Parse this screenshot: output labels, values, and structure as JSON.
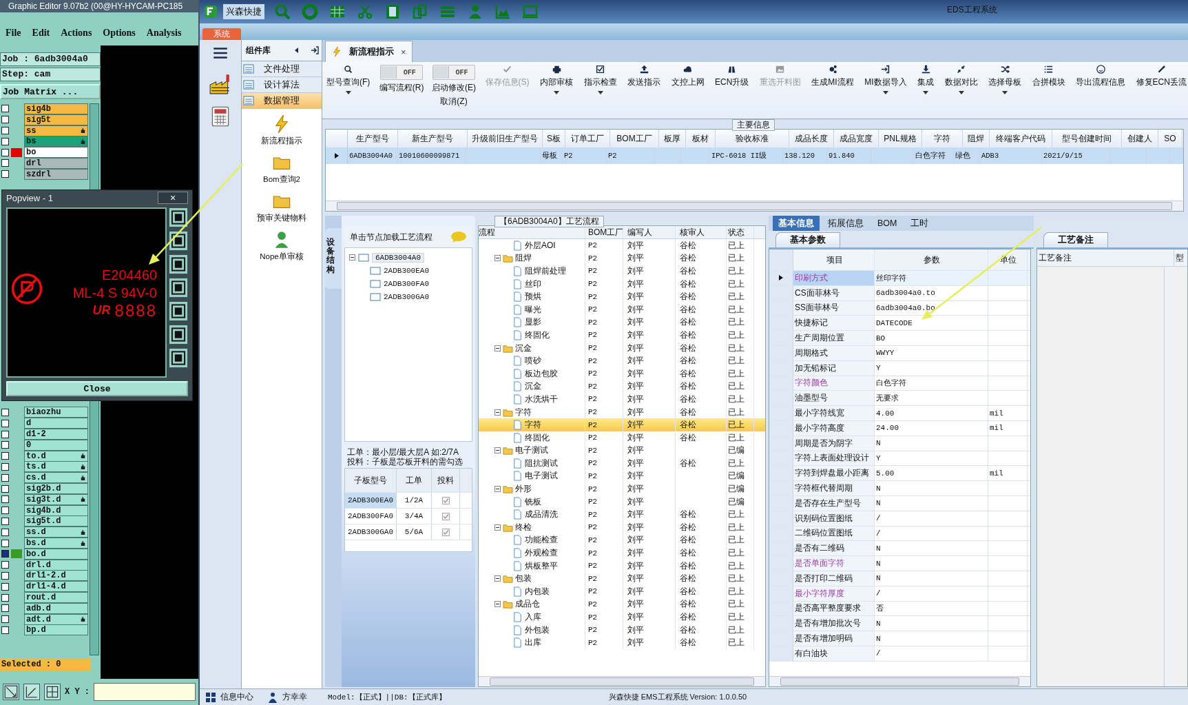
{
  "cam": {
    "title": "Graphic Editor 9.07b2 (00@HY-HYCAM-PC185",
    "menu": [
      "File",
      "Edit",
      "Actions",
      "Options",
      "Analysis"
    ],
    "job": "Job : 6adb3004a0",
    "step": "Step: cam",
    "matrix_button": "Job Matrix ...",
    "layers_top": [
      {
        "name": "sig4b",
        "color": "#f5b942",
        "flag": false,
        "selected": false
      },
      {
        "name": "sig5t",
        "color": "#f5b942",
        "flag": false,
        "selected": false
      },
      {
        "name": "ss",
        "color": "#f5b942",
        "flag": true,
        "selected": false
      },
      {
        "name": "bs",
        "color": "#1aa37a",
        "flag": true,
        "selected": false
      },
      {
        "name": "bo",
        "color": "#ffffff",
        "chip": {
          "color": "#e00000"
        },
        "flag": false,
        "selected": false
      },
      {
        "name": "drl",
        "color": "#a9b8b8",
        "flag": false,
        "selected": false
      },
      {
        "name": "szdrl",
        "color": "#a9b8b8",
        "flag": false,
        "selected": false
      }
    ],
    "layers_bottom": [
      {
        "name": "biaozhu",
        "color": "#9fe3d3",
        "flag": false,
        "selected": false
      },
      {
        "name": "d",
        "color": "#9fe3d3",
        "flag": false,
        "selected": false
      },
      {
        "name": "d1-2",
        "color": "#9fe3d3",
        "flag": false,
        "selected": false
      },
      {
        "name": "0",
        "color": "#9fe3d3",
        "flag": false,
        "selected": false
      },
      {
        "name": "to.d",
        "color": "#9fe3d3",
        "flag": true,
        "selected": false
      },
      {
        "name": "ts.d",
        "color": "#9fe3d3",
        "flag": true,
        "selected": false
      },
      {
        "name": "cs.d",
        "color": "#9fe3d3",
        "flag": true,
        "selected": false
      },
      {
        "name": "sig2b.d",
        "color": "#9fe3d3",
        "flag": false,
        "selected": false
      },
      {
        "name": "sig3t.d",
        "color": "#9fe3d3",
        "flag": true,
        "selected": false
      },
      {
        "name": "sig4b.d",
        "color": "#9fe3d3",
        "flag": false,
        "selected": false
      },
      {
        "name": "sig5t.d",
        "color": "#9fe3d3",
        "flag": false,
        "selected": false
      },
      {
        "name": "ss.d",
        "color": "#9fe3d3",
        "flag": true,
        "selected": false
      },
      {
        "name": "bs.d",
        "color": "#9fe3d3",
        "flag": true,
        "selected": false
      },
      {
        "name": "bo.d",
        "color": "#9fe3d3",
        "chip": {
          "color": "#3a9a2a"
        },
        "flag": false,
        "selected": true
      },
      {
        "name": "drl.d",
        "color": "#9fe3d3",
        "flag": false,
        "selected": false
      },
      {
        "name": "drl1-2.d",
        "color": "#9fe3d3",
        "flag": false,
        "selected": false
      },
      {
        "name": "drl1-4.d",
        "color": "#9fe3d3",
        "flag": false,
        "selected": false
      },
      {
        "name": "rout.d",
        "color": "#9fe3d3",
        "flag": false,
        "selected": false
      },
      {
        "name": "adb.d",
        "color": "#9fe3d3",
        "flag": false,
        "selected": false
      },
      {
        "name": "adt.d",
        "color": "#9fe3d3",
        "flag": true,
        "selected": false
      },
      {
        "name": "bp.d",
        "color": "#9fe3d3",
        "flag": false,
        "selected": false
      }
    ],
    "selected_count": "Selected : 0",
    "xy_label": "X Y :",
    "popview": {
      "title": "Popview - 1",
      "close_x": "×",
      "lines": [
        "E204460",
        "ML-4 S 94V-0",
        "8888"
      ],
      "ur": "UR",
      "close": "Close"
    }
  },
  "app": {
    "brand": "兴森快捷",
    "title": "EDS工程系统",
    "system_tab": "系统",
    "component_title": "组件库",
    "components": [
      {
        "label": "文件处理",
        "selected": false
      },
      {
        "label": "设计算法",
        "selected": false
      },
      {
        "label": "数据管理",
        "selected": true
      }
    ],
    "launchers": [
      "新流程指示",
      "Bom查询2",
      "预审关键物料",
      "Nope单审核"
    ],
    "doc_tab": {
      "label": "新流程指示",
      "close": "×"
    },
    "toolbar": [
      {
        "kind": "button",
        "label": "型号查询(F)",
        "dropdown": true,
        "disabled": false
      },
      {
        "kind": "toggle",
        "toggle": "OFF",
        "on": false,
        "label": "编写流程(R)"
      },
      {
        "kind": "toggle",
        "toggle": "OFF",
        "on": false,
        "label": "启动修改(E)",
        "sub": "取消(Z)"
      },
      {
        "kind": "button",
        "label": "保存信息(S)",
        "dropdown": false,
        "disabled": true
      },
      {
        "kind": "button",
        "label": "内部审核",
        "dropdown": true,
        "disabled": false
      },
      {
        "kind": "button",
        "label": "指示检查",
        "dropdown": true,
        "disabled": false
      },
      {
        "kind": "button",
        "label": "发送指示",
        "dropdown": false,
        "disabled": false
      },
      {
        "kind": "button",
        "label": "文控上网",
        "dropdown": false,
        "disabled": false
      },
      {
        "kind": "button",
        "label": "ECN升级",
        "dropdown": false,
        "disabled": false
      },
      {
        "kind": "button",
        "label": "重选开料图",
        "dropdown": false,
        "disabled": true
      },
      {
        "kind": "button",
        "label": "生成MI流程",
        "dropdown": false,
        "disabled": false
      },
      {
        "kind": "button",
        "label": "MI数据导入",
        "dropdown": true,
        "disabled": false
      },
      {
        "kind": "button",
        "label": "集成",
        "dropdown": true,
        "disabled": false
      },
      {
        "kind": "button",
        "label": "数据对比",
        "dropdown": true,
        "disabled": false
      },
      {
        "kind": "button",
        "label": "选择母板",
        "dropdown": true,
        "disabled": false
      },
      {
        "kind": "button",
        "label": "合拼模块",
        "dropdown": false,
        "disabled": false
      },
      {
        "kind": "button",
        "label": "导出流程信息",
        "dropdown": false,
        "disabled": false
      },
      {
        "kind": "button",
        "label": "修复ECN丢流",
        "dropdown": false,
        "disabled": false
      }
    ],
    "main_info": {
      "title": "主要信息",
      "columns": [
        "生产型号",
        "新生产型号",
        "升级前旧生产型号",
        "S板",
        "订单工厂",
        "BOM工厂",
        "板厚",
        "板材",
        "验收标准",
        "成品长度",
        "成品宽度",
        "PNL规格",
        "字符",
        "阻焊",
        "终端客户代码",
        "型号创建时间",
        "创建人",
        "SO"
      ],
      "rows": [
        {
          "selected": true,
          "cells": [
            "6ADB3004A0",
            "10010600099871",
            "",
            "母板",
            "P2",
            "P2",
            "",
            "",
            "IPC-6018 II级",
            "138.120",
            "91.840",
            "",
            "白色字符",
            "绿色",
            "ADB3",
            "2021/9/15",
            "",
            ""
          ]
        }
      ]
    },
    "structure": {
      "side_tab": "设备结构",
      "hint": "单击节点加载工艺流程",
      "tree": {
        "label": "6ADB3004A0",
        "expanded": true,
        "children": [
          "2ADB300EA0",
          "2ADB300FA0",
          "2ADB300GA0"
        ]
      },
      "note": [
        "工单：最小层/最大层A 如:2/7A",
        "投料：子板是芯板开料的需勾选"
      ],
      "columns": [
        "子板型号",
        "工单",
        "投料"
      ],
      "rows": [
        {
          "model": "2ADB300EA0",
          "order": "1/2A",
          "checked": true,
          "selected": true
        },
        {
          "model": "2ADB300FA0",
          "order": "3/4A",
          "checked": true,
          "selected": false
        },
        {
          "model": "2ADB300GA0",
          "order": "5/6A",
          "checked": true,
          "selected": false
        }
      ]
    },
    "flow": {
      "title": "【6ADB3004A0】工艺流程",
      "columns": [
        "流程",
        "BOM工厂",
        "编写人",
        "核审人",
        "状态"
      ],
      "items": [
        {
          "name": "外层AOI",
          "factory": "P2",
          "writer": "刘平",
          "reviewer": "谷松",
          "status": "已上",
          "selected": false
        },
        {
          "name": "阻焊",
          "factory": "P2",
          "writer": "刘平",
          "reviewer": "谷松",
          "status": "已上",
          "selected": false,
          "expanded": true,
          "children": [
            {
              "name": "阻焊前处理",
              "factory": "P2",
              "writer": "刘平",
              "reviewer": "谷松",
              "status": "已上",
              "selected": false
            },
            {
              "name": "丝印",
              "factory": "P2",
              "writer": "刘平",
              "reviewer": "谷松",
              "status": "已上",
              "selected": false
            },
            {
              "name": "预烘",
              "factory": "P2",
              "writer": "刘平",
              "reviewer": "谷松",
              "status": "已上",
              "selected": false
            },
            {
              "name": "曝光",
              "factory": "P2",
              "writer": "刘平",
              "reviewer": "谷松",
              "status": "已上",
              "selected": false
            },
            {
              "name": "显影",
              "factory": "P2",
              "writer": "刘平",
              "reviewer": "谷松",
              "status": "已上",
              "selected": false
            },
            {
              "name": "终固化",
              "factory": "P2",
              "writer": "刘平",
              "reviewer": "谷松",
              "status": "已上",
              "selected": false
            }
          ]
        },
        {
          "name": "沉金",
          "factory": "P2",
          "writer": "刘平",
          "reviewer": "谷松",
          "status": "已上",
          "selected": false,
          "expanded": true,
          "children": [
            {
              "name": "喷砂",
              "factory": "P2",
              "writer": "刘平",
              "reviewer": "谷松",
              "status": "已上",
              "selected": false
            },
            {
              "name": "板边包胶",
              "factory": "P2",
              "writer": "刘平",
              "reviewer": "谷松",
              "status": "已上",
              "selected": false
            },
            {
              "name": "沉金",
              "factory": "P2",
              "writer": "刘平",
              "reviewer": "谷松",
              "status": "已上",
              "selected": false
            },
            {
              "name": "水洗烘干",
              "factory": "P2",
              "writer": "刘平",
              "reviewer": "谷松",
              "status": "已上",
              "selected": false
            }
          ]
        },
        {
          "name": "字符",
          "factory": "P2",
          "writer": "刘平",
          "reviewer": "谷松",
          "status": "已上",
          "selected": false,
          "expanded": true,
          "children": [
            {
              "name": "字符",
              "factory": "P2",
              "writer": "刘平",
              "reviewer": "谷松",
              "status": "已上",
              "selected": true
            },
            {
              "name": "终固化",
              "factory": "P2",
              "writer": "刘平",
              "reviewer": "谷松",
              "status": "已上",
              "selected": false
            }
          ]
        },
        {
          "name": "电子测试",
          "factory": "P2",
          "writer": "刘平",
          "status": "已编",
          "selected": false,
          "expanded": true,
          "children": [
            {
              "name": "阻抗测试",
              "factory": "P2",
              "writer": "刘平",
              "reviewer": "谷松",
              "status": "已上",
              "selected": false
            },
            {
              "name": "电子测试",
              "factory": "P2",
              "writer": "刘平",
              "status": "已编",
              "selected": false
            }
          ]
        },
        {
          "name": "外形",
          "factory": "P2",
          "writer": "刘平",
          "status": "已编",
          "selected": false,
          "expanded": true,
          "children": [
            {
              "name": "铣板",
              "factory": "P2",
              "writer": "刘平",
              "status": "已编",
              "selected": false
            },
            {
              "name": "成品清洗",
              "factory": "P2",
              "writer": "刘平",
              "reviewer": "谷松",
              "status": "已上",
              "selected": false
            }
          ]
        },
        {
          "name": "终检",
          "factory": "P2",
          "writer": "刘平",
          "reviewer": "谷松",
          "status": "已上",
          "selected": false,
          "expanded": true,
          "children": [
            {
              "name": "功能检查",
              "factory": "P2",
              "writer": "刘平",
              "reviewer": "谷松",
              "status": "已上",
              "selected": false
            },
            {
              "name": "外观检查",
              "factory": "P2",
              "writer": "刘平",
              "reviewer": "谷松",
              "status": "已上",
              "selected": false
            },
            {
              "name": "烘板整平",
              "factory": "P2",
              "writer": "刘平",
              "reviewer": "谷松",
              "status": "已上",
              "selected": false
            }
          ]
        },
        {
          "name": "包装",
          "factory": "P2",
          "writer": "刘平",
          "reviewer": "谷松",
          "status": "已上",
          "selected": false,
          "expanded": true,
          "children": [
            {
              "name": "内包装",
              "factory": "P2",
              "writer": "刘平",
              "reviewer": "谷松",
              "status": "已上",
              "selected": false
            }
          ]
        },
        {
          "name": "成品仓",
          "factory": "P2",
          "writer": "刘平",
          "reviewer": "谷松",
          "status": "已上",
          "selected": false,
          "expanded": true,
          "children": [
            {
              "name": "入库",
              "factory": "P2",
              "writer": "刘平",
              "reviewer": "谷松",
              "status": "已上",
              "selected": false
            },
            {
              "name": "外包装",
              "factory": "P2",
              "writer": "刘平",
              "reviewer": "谷松",
              "status": "已上",
              "selected": false
            },
            {
              "name": "出库",
              "factory": "P2",
              "writer": "刘平",
              "reviewer": "谷松",
              "status": "已上",
              "selected": false
            }
          ]
        }
      ]
    },
    "info_tabs": [
      {
        "label": "基本信息",
        "selected": true
      },
      {
        "label": "拓展信息",
        "selected": false
      },
      {
        "label": "BOM",
        "selected": false
      },
      {
        "label": "工时",
        "selected": false
      }
    ],
    "params": {
      "tab": "基本参数",
      "columns": [
        "项目",
        "参数",
        "单位"
      ],
      "rows": [
        {
          "item": "印刷方式",
          "value": "丝印字符",
          "highlight": true,
          "selected": true
        },
        {
          "item": "CS面菲林号",
          "value": "6adb3004a0.to",
          "highlight": false,
          "selected": false
        },
        {
          "item": "SS面菲林号",
          "value": "6adb3004a0.bo",
          "highlight": false,
          "selected": false
        },
        {
          "item": "快捷标记",
          "value": "DATECODE",
          "highlight": false,
          "selected": false
        },
        {
          "item": "生产周期位置",
          "value": "BO",
          "highlight": false,
          "selected": false
        },
        {
          "item": "周期格式",
          "value": "WWYY",
          "highlight": false,
          "selected": false
        },
        {
          "item": "加无铅标记",
          "value": "Y",
          "highlight": false,
          "selected": false
        },
        {
          "item": "字符颜色",
          "value": "白色字符",
          "highlight": true,
          "selected": false
        },
        {
          "item": "油墨型号",
          "value": "无要求",
          "highlight": false,
          "selected": false
        },
        {
          "item": "最小字符线宽",
          "value": "4.00",
          "unit": "mil",
          "highlight": false,
          "selected": false
        },
        {
          "item": "最小字符高度",
          "value": "24.00",
          "unit": "mil",
          "highlight": false,
          "selected": false
        },
        {
          "item": "周期是否为阴字",
          "value": "N",
          "highlight": false,
          "selected": false
        },
        {
          "item": "字符上表面处理设计",
          "value": "Y",
          "highlight": false,
          "selected": false
        },
        {
          "item": "字符到焊盘最小距离",
          "value": "5.00",
          "unit": "mil",
          "highlight": false,
          "selected": false
        },
        {
          "item": "字符框代替周期",
          "value": "N",
          "highlight": false,
          "selected": false
        },
        {
          "item": "是否存在生产型号",
          "value": "N",
          "highlight": false,
          "selected": false
        },
        {
          "item": "识别码位置图纸",
          "value": "/",
          "highlight": false,
          "selected": false
        },
        {
          "item": "二维码位置图纸",
          "value": "/",
          "highlight": false,
          "selected": false
        },
        {
          "item": "是否有二维码",
          "value": "N",
          "highlight": false,
          "selected": false
        },
        {
          "item": "是否单面字符",
          "value": "N",
          "highlight": true,
          "selected": false
        },
        {
          "item": "是否打印二维码",
          "value": "N",
          "highlight": false,
          "selected": false
        },
        {
          "item": "最小字符厚度",
          "value": "/",
          "highlight": true,
          "selected": false
        },
        {
          "item": "是否高平整度要求",
          "value": "否",
          "highlight": false,
          "selected": false
        },
        {
          "item": "是否有增加批次号",
          "value": "N",
          "highlight": false,
          "selected": false
        },
        {
          "item": "是否有增加明码",
          "value": "N",
          "highlight": false,
          "selected": false
        },
        {
          "item": "有白油块",
          "value": "/",
          "highlight": false,
          "selected": false
        }
      ]
    },
    "remarks": {
      "tab": "工艺备注",
      "columns": [
        "工艺备注",
        "型"
      ]
    },
    "status_bar": {
      "items": [
        "信息中心",
        "方幸幸"
      ],
      "model": "Model:【正式】||DB:【正式库】",
      "version": "兴森快捷  EMS工程系统  Version: 1.0.0.50"
    }
  }
}
